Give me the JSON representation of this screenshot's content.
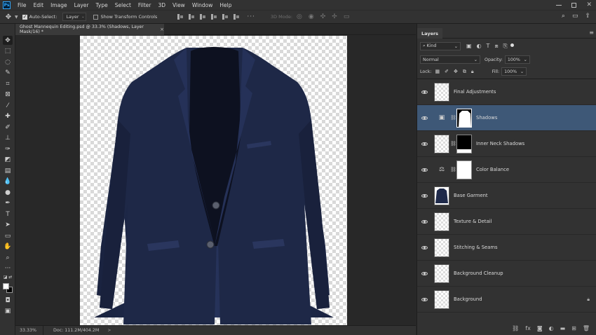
{
  "menubar": {
    "logo": "Ps",
    "items": [
      "File",
      "Edit",
      "Image",
      "Layer",
      "Type",
      "Select",
      "Filter",
      "3D",
      "View",
      "Window",
      "Help"
    ]
  },
  "options": {
    "auto_select_label": "Auto-Select:",
    "auto_select_checked": true,
    "target_value": "Layer",
    "show_transform_label": "Show Transform Controls",
    "mode_3d_label": "3D Mode:"
  },
  "document": {
    "tab_title": "Ghost Mannequin Editing.psd @ 33.3% (Shadows, Layer Mask/16) *"
  },
  "status": {
    "zoom": "33.33%",
    "doc": "Doc: 111.2M/404.2M"
  },
  "layers_panel": {
    "tab": "Layers",
    "kind_label": "Kind",
    "blend_mode": "Normal",
    "opacity_label": "Opacity:",
    "opacity_value": "100%",
    "lock_label": "Lock:",
    "fill_label": "Fill:",
    "fill_value": "100%",
    "layers": [
      {
        "name": "Final Adjustments",
        "selected": false
      },
      {
        "name": "Shadows",
        "selected": true
      },
      {
        "name": "Inner Neck Shadows",
        "selected": false
      },
      {
        "name": "Color Balance",
        "selected": false
      },
      {
        "name": "Base Garment",
        "selected": false
      },
      {
        "name": "Texture & Detail",
        "selected": false
      },
      {
        "name": "Stitching & Seams",
        "selected": false
      },
      {
        "name": "Background Cleanup",
        "selected": false
      },
      {
        "name": "Background",
        "selected": false,
        "locked": true
      }
    ]
  },
  "colors": {
    "jacket": "#1f2a4a",
    "selection": "#3e5877",
    "accent": "#31a8ff"
  }
}
